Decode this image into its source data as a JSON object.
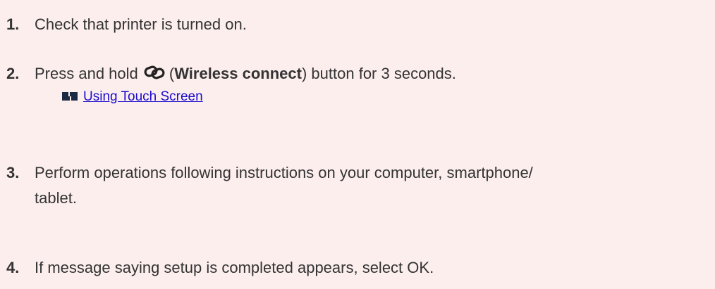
{
  "steps": [
    {
      "number": "1.",
      "text": "Check that printer is turned on."
    },
    {
      "number": "2.",
      "text_before": "Press and hold",
      "icon": "wireless-connect-icon",
      "paren_open": "(",
      "bold_text": "Wireless connect",
      "text_after": ") button for 3 seconds."
    },
    {
      "number": "3.",
      "text_line1": "Perform operations following instructions on your computer, smartphone/",
      "text_line2": "tablet."
    },
    {
      "number": "4.",
      "text": "If message saying setup is completed appears, select OK."
    }
  ],
  "link": {
    "icon": "page-link-icon",
    "label": "Using Touch Screen"
  },
  "colors": {
    "background": "#fdeeee",
    "text": "#333333",
    "link": "#1a0dcc"
  }
}
